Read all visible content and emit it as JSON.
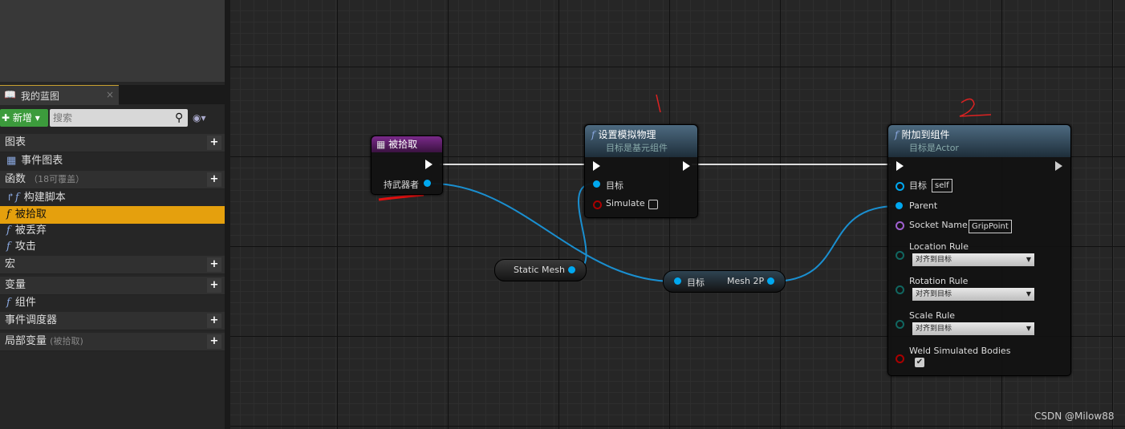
{
  "panel": {
    "tab": "我的蓝图",
    "new_btn": "新增",
    "search_placeholder": "搜索",
    "rows": [
      {
        "label": "图表",
        "type": "header"
      },
      {
        "label": "事件图表",
        "type": "item"
      },
      {
        "label": "函数",
        "note": "（18可覆盖）",
        "type": "header"
      },
      {
        "label": "构建脚本",
        "type": "item"
      },
      {
        "label": "被拾取",
        "type": "selected"
      },
      {
        "label": "被丢弃",
        "type": "item"
      },
      {
        "label": "攻击",
        "type": "item"
      },
      {
        "label": "宏",
        "type": "header"
      },
      {
        "label": "变量",
        "type": "header"
      },
      {
        "label": "组件",
        "type": "item"
      },
      {
        "label": "事件调度器",
        "type": "header"
      },
      {
        "label": "局部变量",
        "note": "(被拾取)",
        "type": "header"
      }
    ]
  },
  "nodes": {
    "event": {
      "title": "被拾取",
      "pin": "持武器者"
    },
    "setsim": {
      "title": "设置模拟物理",
      "subtitle": "目标是基元组件",
      "target": "目标",
      "simulate": "Simulate"
    },
    "attach": {
      "title": "附加到组件",
      "subtitle": "目标是Actor",
      "target": "目标",
      "target_val": "self",
      "parent": "Parent",
      "socket": "Socket Name",
      "socket_val": "GripPoint",
      "loc": "Location Rule",
      "rot": "Rotation Rule",
      "scale": "Scale Rule",
      "rule_val": "对齐到目标",
      "weld": "Weld Simulated Bodies",
      "weld_checked": true
    },
    "staticmesh": {
      "label": "Static Mesh"
    },
    "mesh2p": {
      "target": "目标",
      "out": "Mesh 2P"
    }
  },
  "annotations": {
    "one": "1",
    "two": "2"
  },
  "watermark": "CSDN @Milow88"
}
